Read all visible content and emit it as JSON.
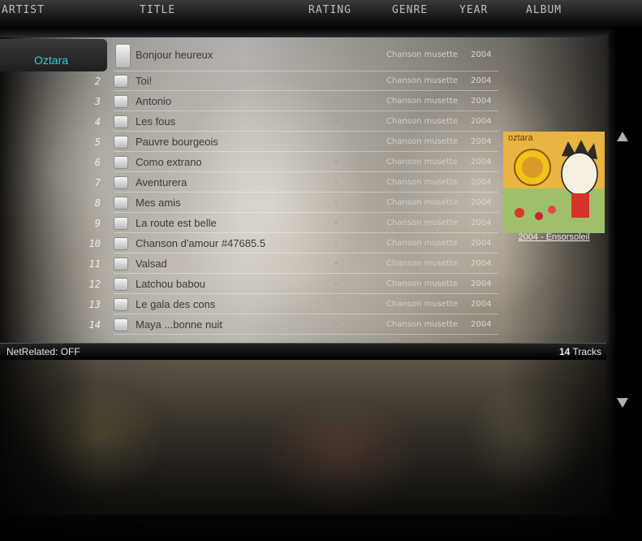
{
  "columns": {
    "artist": "ARTIST",
    "title": "TITLE",
    "rating": "RATING",
    "genre": "GENRE",
    "year": "YEAR",
    "album": "ALBUM"
  },
  "artist": "Oztara",
  "tracks": [
    {
      "num": "",
      "title": "Bonjour heureux",
      "rating": "-",
      "genre": "Chanson musette",
      "year": "2004"
    },
    {
      "num": "2",
      "title": "Toi!",
      "rating": "-",
      "genre": "Chanson musette",
      "year": "2004"
    },
    {
      "num": "3",
      "title": "Antonio",
      "rating": "-",
      "genre": "Chanson musette",
      "year": "2004"
    },
    {
      "num": "4",
      "title": "Les fous",
      "rating": "-",
      "genre": "Chanson musette",
      "year": "2004"
    },
    {
      "num": "5",
      "title": "Pauvre bourgeois",
      "rating": "-",
      "genre": "Chanson musette",
      "year": "2004"
    },
    {
      "num": "6",
      "title": "Como extrano",
      "rating": "-",
      "genre": "Chanson musette",
      "year": "2004"
    },
    {
      "num": "7",
      "title": "Aventurera",
      "rating": "-",
      "genre": "Chanson musette",
      "year": "2004"
    },
    {
      "num": "8",
      "title": "Mes amis",
      "rating": "-",
      "genre": "Chanson musette",
      "year": "2004"
    },
    {
      "num": "9",
      "title": "La route est belle",
      "rating": "-",
      "genre": "Chanson musette",
      "year": "2004"
    },
    {
      "num": "10",
      "title": "Chanson d'amour #47685.5",
      "rating": "-",
      "genre": "Chanson musette",
      "year": "2004"
    },
    {
      "num": "11",
      "title": "Valsad",
      "rating": "-",
      "genre": "Chanson musette",
      "year": "2004"
    },
    {
      "num": "12",
      "title": "Latchou babou",
      "rating": "-",
      "genre": "Chanson musette",
      "year": "2004"
    },
    {
      "num": "13",
      "title": "Le gala des cons",
      "rating": "-",
      "genre": "Chanson musette",
      "year": "2004"
    },
    {
      "num": "14",
      "title": "Maya ...bonne nuit",
      "rating": "-",
      "genre": "Chanson musette",
      "year": "2004"
    }
  ],
  "album": {
    "cover_text": "oztara",
    "label": "2004 - Ensorsoleil"
  },
  "status": {
    "net_related": "NetRelated: OFF",
    "track_count": "14",
    "tracks_label": "Tracks"
  },
  "scroll": {
    "up_icon": "arrow-up-icon",
    "down_icon": "arrow-down-icon"
  },
  "colors": {
    "artist_accent": "#2ecbe6",
    "cover_bg": "#cfd97a"
  }
}
